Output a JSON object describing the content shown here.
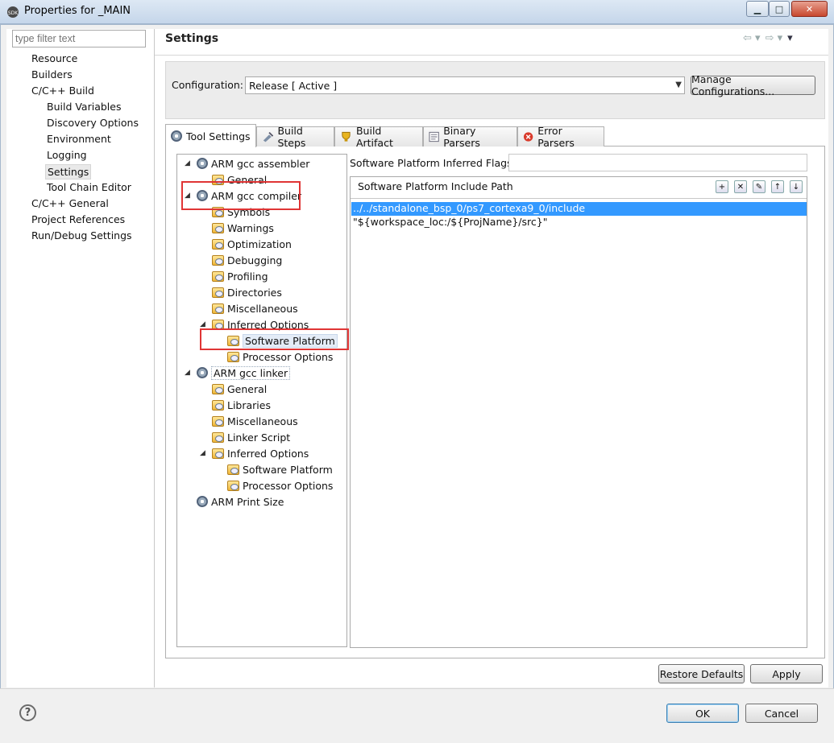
{
  "window": {
    "title": "Properties for _MAIN",
    "minimize": "▁",
    "maximize": "□",
    "close": "✕"
  },
  "filter": {
    "placeholder": "type filter text"
  },
  "nav": [
    {
      "label": "Resource",
      "level": 0
    },
    {
      "label": "Builders",
      "level": 0
    },
    {
      "label": "C/C++ Build",
      "level": 0
    },
    {
      "label": "Build Variables",
      "level": 1
    },
    {
      "label": "Discovery Options",
      "level": 1
    },
    {
      "label": "Environment",
      "level": 1
    },
    {
      "label": "Logging",
      "level": 1
    },
    {
      "label": "Settings",
      "level": 1,
      "selected": true
    },
    {
      "label": "Tool Chain Editor",
      "level": 1
    },
    {
      "label": "C/C++ General",
      "level": 0
    },
    {
      "label": "Project References",
      "level": 0
    },
    {
      "label": "Run/Debug Settings",
      "level": 0
    }
  ],
  "header": {
    "title": "Settings",
    "back": "⇦ ▾",
    "forward": "⇨ ▾",
    "menu": "▾"
  },
  "config": {
    "label": "Configuration:",
    "value": "Release  [ Active ]",
    "manage_button": "Manage Configurations..."
  },
  "tabs": [
    {
      "label": "Tool Settings",
      "icon": "gear-icon",
      "active": true
    },
    {
      "label": "Build Steps",
      "icon": "build-steps-icon"
    },
    {
      "label": "Build Artifact",
      "icon": "trophy-icon"
    },
    {
      "label": "Binary Parsers",
      "icon": "binary-icon"
    },
    {
      "label": "Error Parsers",
      "icon": "error-icon"
    }
  ],
  "tree": [
    {
      "label": "ARM gcc assembler",
      "depth": 0,
      "icon": "gear",
      "toggle": "◢"
    },
    {
      "label": "General",
      "depth": 1,
      "icon": "folder"
    },
    {
      "label": "ARM gcc compiler",
      "depth": 0,
      "icon": "gear",
      "toggle": "◢"
    },
    {
      "label": "Symbols",
      "depth": 1,
      "icon": "folder"
    },
    {
      "label": "Warnings",
      "depth": 1,
      "icon": "folder"
    },
    {
      "label": "Optimization",
      "depth": 1,
      "icon": "folder"
    },
    {
      "label": "Debugging",
      "depth": 1,
      "icon": "folder"
    },
    {
      "label": "Profiling",
      "depth": 1,
      "icon": "folder"
    },
    {
      "label": "Directories",
      "depth": 1,
      "icon": "folder"
    },
    {
      "label": "Miscellaneous",
      "depth": 1,
      "icon": "folder"
    },
    {
      "label": "Inferred Options",
      "depth": 1,
      "icon": "folder",
      "toggle": "◢"
    },
    {
      "label": "Software Platform",
      "depth": 2,
      "icon": "folder",
      "selected": true
    },
    {
      "label": "Processor Options",
      "depth": 2,
      "icon": "folder"
    },
    {
      "label": "ARM gcc linker",
      "depth": 0,
      "icon": "gear",
      "toggle": "◢",
      "dotted": true
    },
    {
      "label": "General",
      "depth": 1,
      "icon": "folder"
    },
    {
      "label": "Libraries",
      "depth": 1,
      "icon": "folder"
    },
    {
      "label": "Miscellaneous",
      "depth": 1,
      "icon": "folder"
    },
    {
      "label": "Linker Script",
      "depth": 1,
      "icon": "folder"
    },
    {
      "label": "Inferred Options",
      "depth": 1,
      "icon": "folder",
      "toggle": "◢"
    },
    {
      "label": "Software Platform",
      "depth": 2,
      "icon": "folder"
    },
    {
      "label": "Processor Options",
      "depth": 2,
      "icon": "folder"
    },
    {
      "label": "ARM Print Size",
      "depth": 0,
      "icon": "gear"
    }
  ],
  "right": {
    "flags_label": "Software Platform Inferred Flags",
    "flags_value": "",
    "include_label": "Software Platform Include Path",
    "toolbar": [
      {
        "name": "add-include-icon",
        "glyph": "+"
      },
      {
        "name": "delete-include-icon",
        "glyph": "✕"
      },
      {
        "name": "edit-include-icon",
        "glyph": "✎"
      },
      {
        "name": "move-up-icon",
        "glyph": "↑"
      },
      {
        "name": "move-down-icon",
        "glyph": "↓"
      }
    ],
    "paths": [
      {
        "value": "../../standalone_bsp_0/ps7_cortexa9_0/include",
        "selected": true
      },
      {
        "value": "\"${workspace_loc:/${ProjName}/src}\""
      }
    ]
  },
  "buttons": {
    "restore": "Restore Defaults",
    "apply": "Apply",
    "ok": "OK",
    "cancel": "Cancel",
    "help": "?"
  }
}
